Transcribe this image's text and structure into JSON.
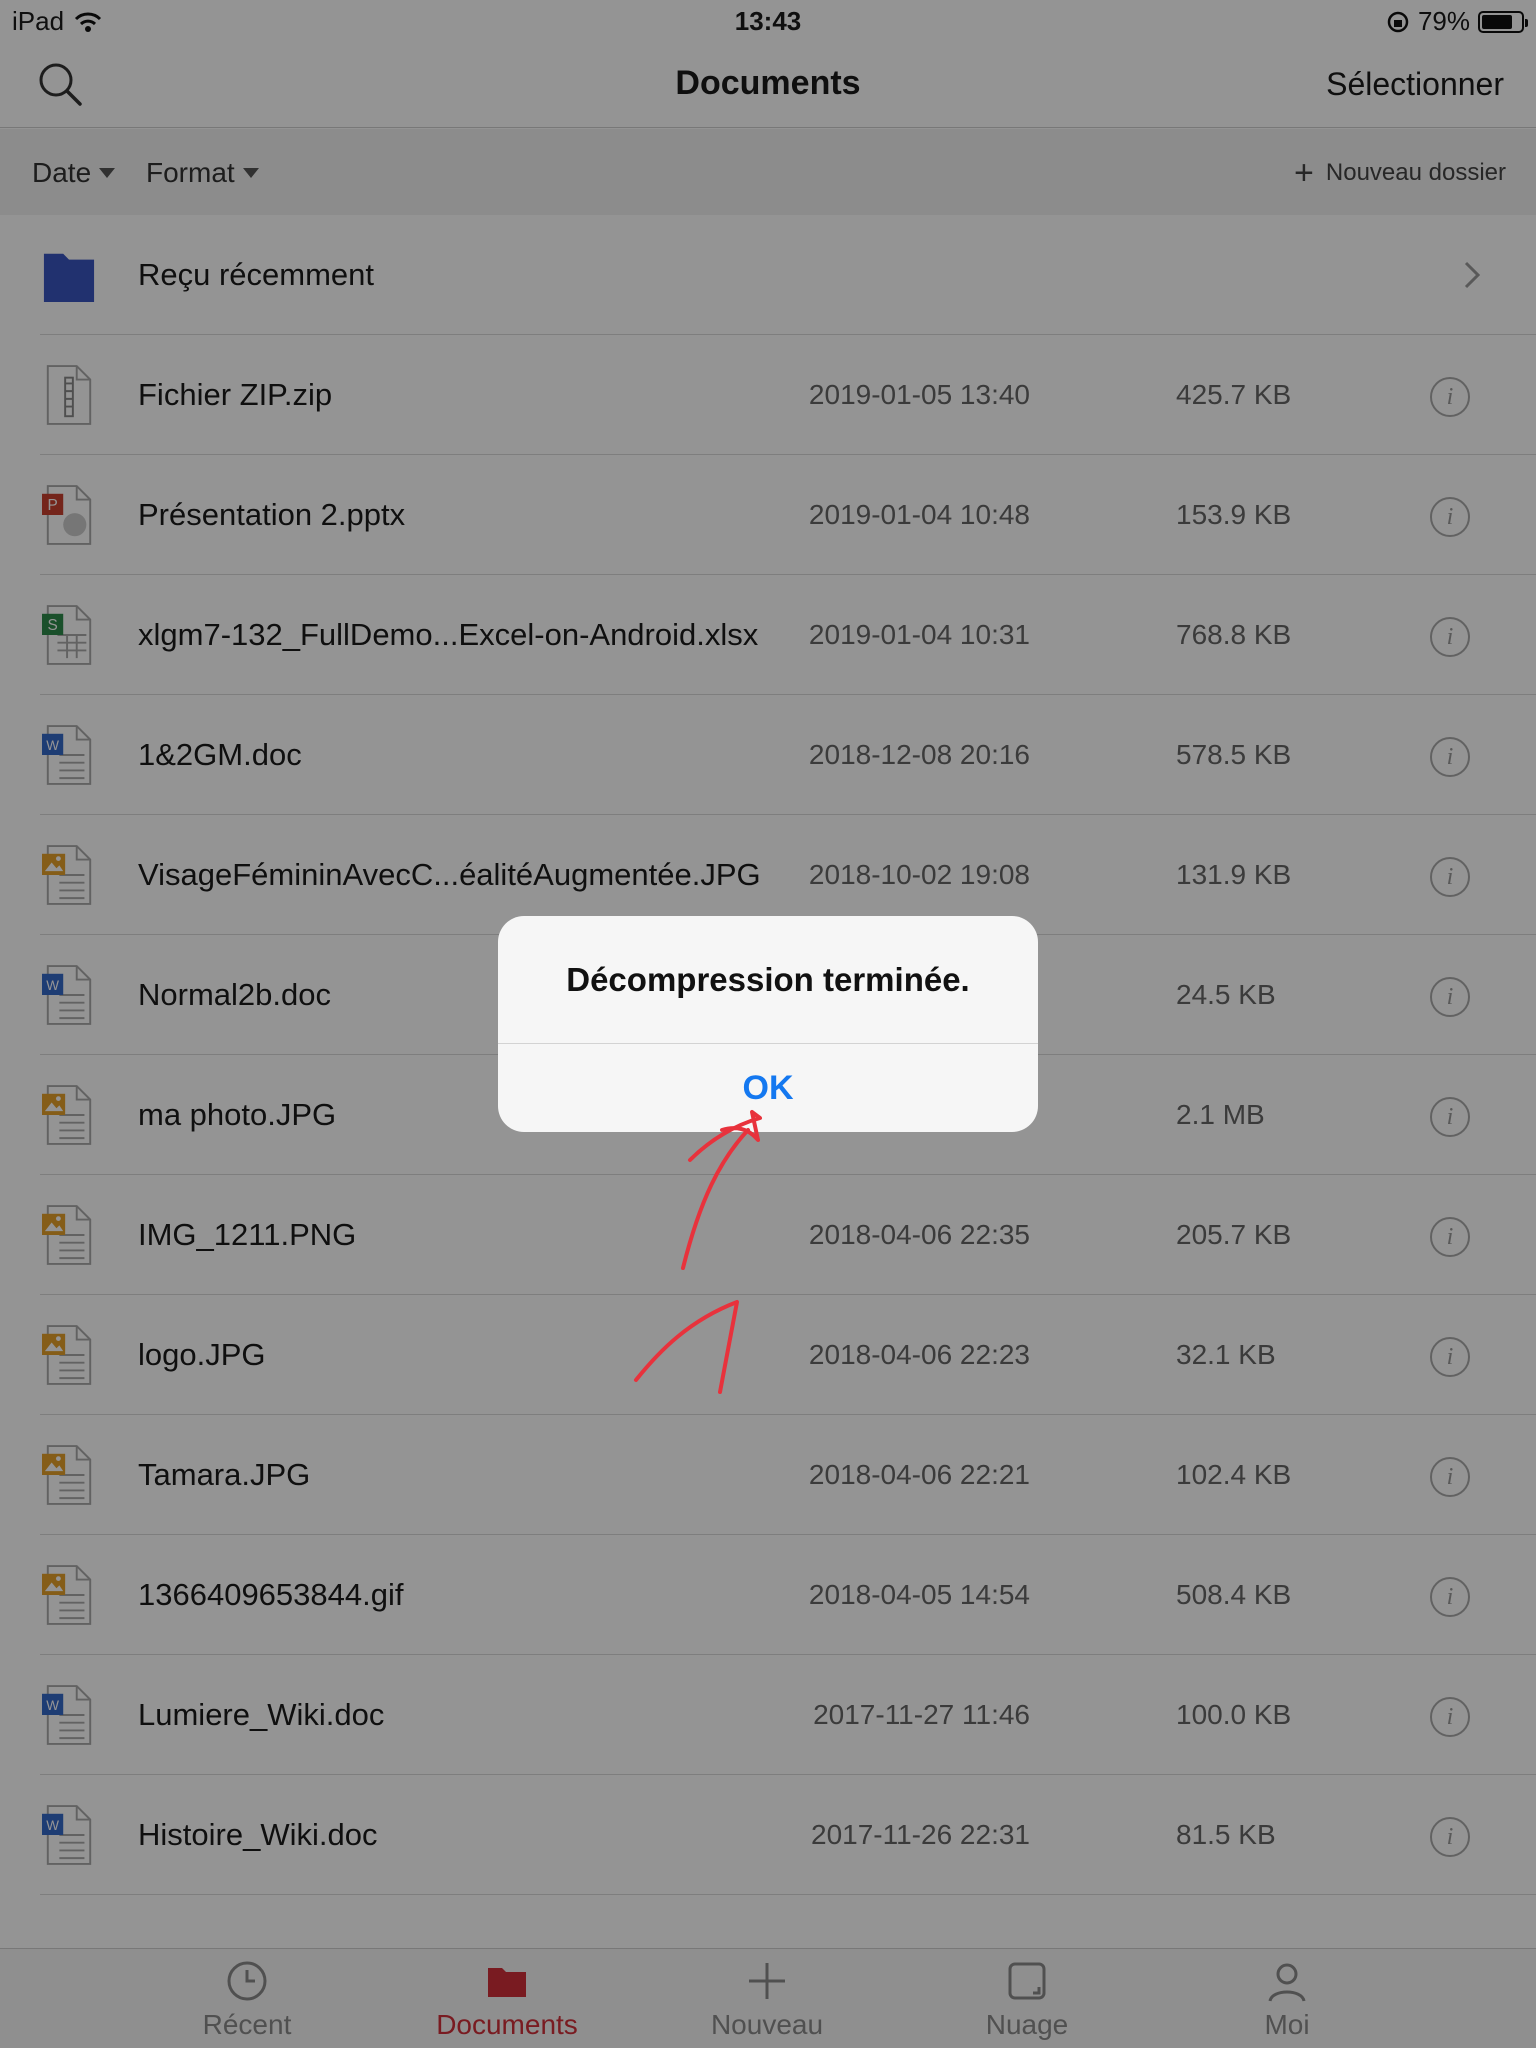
{
  "status_bar": {
    "device": "iPad",
    "time": "13:43",
    "battery": "79%",
    "battery_level": 0.79
  },
  "nav": {
    "title": "Documents",
    "select_label": "Sélectionner"
  },
  "filters": {
    "date_label": "Date",
    "format_label": "Format",
    "new_folder_label": "Nouveau dossier"
  },
  "files": [
    {
      "name": "Reçu récemment",
      "type": "folder",
      "date": "",
      "size": ""
    },
    {
      "name": "Fichier ZIP.zip",
      "type": "zip",
      "date": "2019-01-05 13:40",
      "size": "425.7 KB"
    },
    {
      "name": "Présentation 2.pptx",
      "type": "pptx",
      "date": "2019-01-04 10:48",
      "size": "153.9 KB"
    },
    {
      "name": "xlgm7-132_FullDemo...Excel-on-Android.xlsx",
      "type": "xlsx",
      "date": "2019-01-04 10:31",
      "size": "768.8 KB"
    },
    {
      "name": "1&2GM.doc",
      "type": "doc",
      "date": "2018-12-08 20:16",
      "size": "578.5 KB"
    },
    {
      "name": "VisageFémininAvecC...éalitéAugmentée.JPG",
      "type": "image",
      "date": "2018-10-02 19:08",
      "size": "131.9 KB"
    },
    {
      "name": "Normal2b.doc",
      "type": "doc",
      "date": "",
      "size": "24.5 KB"
    },
    {
      "name": "ma photo.JPG",
      "type": "image",
      "date": "",
      "size": "2.1 MB"
    },
    {
      "name": "IMG_1211.PNG",
      "type": "image",
      "date": "2018-04-06 22:35",
      "size": "205.7 KB"
    },
    {
      "name": "logo.JPG",
      "type": "image",
      "date": "2018-04-06 22:23",
      "size": "32.1 KB"
    },
    {
      "name": "Tamara.JPG",
      "type": "image",
      "date": "2018-04-06 22:21",
      "size": "102.4 KB"
    },
    {
      "name": "1366409653844.gif",
      "type": "image",
      "date": "2018-04-05 14:54",
      "size": "508.4 KB"
    },
    {
      "name": "Lumiere_Wiki.doc",
      "type": "doc",
      "date": "2017-11-27 11:46",
      "size": "100.0 KB"
    },
    {
      "name": "Histoire_Wiki.doc",
      "type": "doc",
      "date": "2017-11-26 22:31",
      "size": "81.5 KB"
    }
  ],
  "tabs": [
    {
      "label": "Récent",
      "icon": "clock-icon",
      "active": false
    },
    {
      "label": "Documents",
      "icon": "folder-icon",
      "active": true
    },
    {
      "label": "Nouveau",
      "icon": "plus-icon",
      "active": false
    },
    {
      "label": "Nuage",
      "icon": "cloud-icon",
      "active": false
    },
    {
      "label": "Moi",
      "icon": "person-icon",
      "active": false
    }
  ],
  "dialog": {
    "message": "Décompression terminée.",
    "ok_label": "OK"
  },
  "colors": {
    "accent_red": "#d0303a",
    "link_blue": "#1478f0",
    "annotation_red": "#e8323c",
    "folder_blue": "#3a55c0"
  }
}
